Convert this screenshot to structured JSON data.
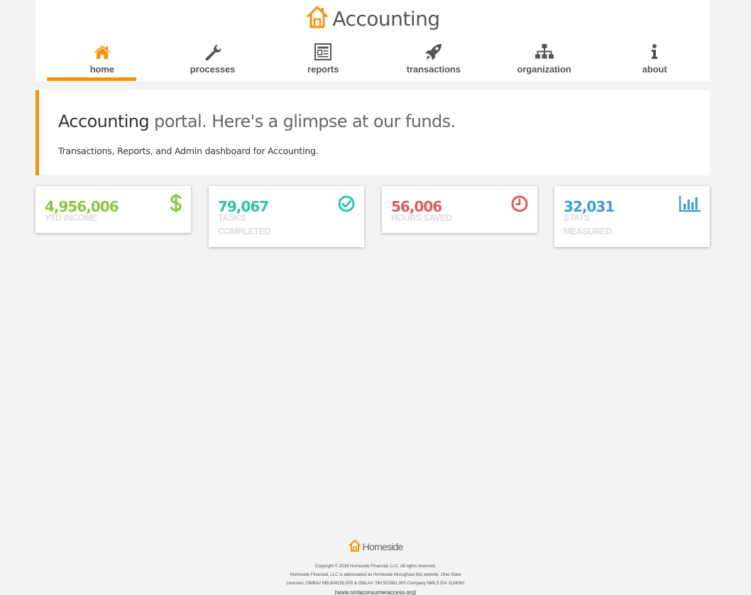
{
  "app": {
    "title": "Accounting"
  },
  "nav": {
    "items": [
      {
        "label": "home",
        "icon": "home-icon",
        "active": true
      },
      {
        "label": "processes",
        "icon": "wrench-icon"
      },
      {
        "label": "reports",
        "icon": "newspaper-icon"
      },
      {
        "label": "transactions",
        "icon": "rocket-icon"
      },
      {
        "label": "organization",
        "icon": "sitemap-icon"
      },
      {
        "label": "about",
        "icon": "info-icon"
      }
    ]
  },
  "hero": {
    "title_strong": "Accounting",
    "title_rest": " portal. Here's a glimpse at our funds.",
    "subtitle": "Transactions, Reports, and Admin dashboard for Accounting."
  },
  "stats": [
    {
      "value": "4,956,006",
      "label": "YTD INCOME",
      "color": "#8cc63f",
      "icon": "dollar-icon"
    },
    {
      "value": "79,067",
      "label": "TASKS COMPLETED",
      "color": "#2ec4a6",
      "icon": "check-circle-icon"
    },
    {
      "value": "56,006",
      "label": "HOURS SAVED",
      "color": "#e05a5e",
      "icon": "clock-icon"
    },
    {
      "value": "32,031",
      "label": "STATS MEASURED",
      "color": "#3b9cd9",
      "icon": "bar-chart-icon"
    }
  ],
  "footer": {
    "logo_text": "Homeside",
    "copyright": "Copyright © 2016 Homeside Financial, LLC. All rights reserved.",
    "line2": "Homeside Financial, LLC is abbreviated as Homeside throughout this website. Ohio State",
    "line3": "Licenses: OMBA# MB.804155.000 & OMLA#: SM.501881.000 Company NMLS ID# 1124061",
    "link": "(www.nmlsconsumeraccess.org)"
  },
  "colors": {
    "accent": "#f5930d",
    "icon": "#555555"
  }
}
